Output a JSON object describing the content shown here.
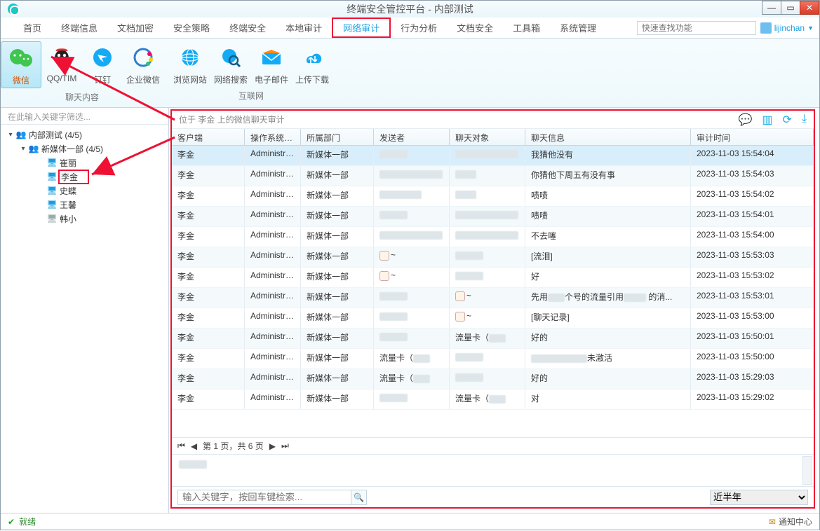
{
  "window": {
    "title": "终端安全管控平台 - 内部测试"
  },
  "menubar": {
    "items": [
      "首页",
      "终端信息",
      "文档加密",
      "安全策略",
      "终端安全",
      "本地审计",
      "网络审计",
      "行为分析",
      "文档安全",
      "工具箱",
      "系统管理"
    ],
    "active_index": 6,
    "search_placeholder": "快速查找功能",
    "user": "lijinchan"
  },
  "ribbon": {
    "group1_caption": "聊天内容",
    "group2_caption": "互联网",
    "buttons": [
      {
        "label": "微信",
        "selected": true
      },
      {
        "label": "QQ/TIM"
      },
      {
        "label": "钉钉"
      },
      {
        "label": "企业微信"
      },
      {
        "label": "浏览网站"
      },
      {
        "label": "网络搜索"
      },
      {
        "label": "电子邮件"
      },
      {
        "label": "上传下载"
      }
    ]
  },
  "sidebar": {
    "filter_placeholder": "在此输入关键字筛选...",
    "tree": {
      "root": {
        "label": "内部测试 (4/5)"
      },
      "child": {
        "label": "新媒体一部 (4/5)"
      },
      "leaves": [
        {
          "label": "崔丽",
          "online": true
        },
        {
          "label": "李金",
          "online": true,
          "selected": true
        },
        {
          "label": "史蝶",
          "online": true
        },
        {
          "label": "王馨",
          "online": true
        },
        {
          "label": "韩小",
          "online": false
        }
      ]
    }
  },
  "content": {
    "path": "位于 李金 上的微信聊天审计",
    "columns": [
      "客户端",
      "操作系统账户",
      "所属部门",
      "发送者",
      "聊天对象",
      "聊天信息",
      "审计时间"
    ],
    "rows": [
      {
        "client": "李金",
        "os": "Administra...",
        "dept": "新媒体一部",
        "sender": "__blur40__",
        "target": "__blur90__",
        "msg": "我猜他没有",
        "time": "2023-11-03 15:54:04",
        "sel": true
      },
      {
        "client": "李金",
        "os": "Administra...",
        "dept": "新媒体一部",
        "sender": "__blur90__",
        "target": "__blur30__",
        "msg": "你猜他下周五有没有事",
        "time": "2023-11-03 15:54:03"
      },
      {
        "client": "李金",
        "os": "Administra...",
        "dept": "新媒体一部",
        "sender": "__blur60__",
        "target": "__blur30__",
        "msg": "啧啧",
        "time": "2023-11-03 15:54:02"
      },
      {
        "client": "李金",
        "os": "Administra...",
        "dept": "新媒体一部",
        "sender": "__blur40__",
        "target": "__blur90__",
        "msg": "啧啧",
        "time": "2023-11-03 15:54:01"
      },
      {
        "client": "李金",
        "os": "Administra...",
        "dept": "新媒体一部",
        "sender": "__blur90__",
        "target": "__blur90__",
        "msg": "不去噻",
        "time": "2023-11-03 15:54:00"
      },
      {
        "client": "李金",
        "os": "Administra...",
        "dept": "新媒体一部",
        "sender": "__emoji__~",
        "target": "__blur40__",
        "msg": "[流泪]",
        "time": "2023-11-03 15:53:03"
      },
      {
        "client": "李金",
        "os": "Administra...",
        "dept": "新媒体一部",
        "sender": "__emoji__~",
        "target": "__blur40__",
        "msg": "好",
        "time": "2023-11-03 15:53:02"
      },
      {
        "client": "李金",
        "os": "Administra...",
        "dept": "新媒体一部",
        "sender": "__blur40__",
        "target": "__emoji__~",
        "msg": "先用███个号的流量引用████ 的消...",
        "time": "2023-11-03 15:53:01"
      },
      {
        "client": "李金",
        "os": "Administra...",
        "dept": "新媒体一部",
        "sender": "__blur40__",
        "target": "__emoji__~",
        "msg": "[聊天记录]",
        "time": "2023-11-03 15:53:00"
      },
      {
        "client": "李金",
        "os": "Administra...",
        "dept": "新媒体一部",
        "sender": "__blur40__",
        "target": "流量卡（███办...",
        "msg": "好的",
        "time": "2023-11-03 15:50:01"
      },
      {
        "client": "李金",
        "os": "Administra...",
        "dept": "新媒体一部",
        "sender": "流量卡（███办...",
        "target": "__blur40__",
        "msg": "██████████未激活",
        "time": "2023-11-03 15:50:00"
      },
      {
        "client": "李金",
        "os": "Administra...",
        "dept": "新媒体一部",
        "sender": "流量卡（███办...",
        "target": "__blur40__",
        "msg": "好的",
        "time": "2023-11-03 15:29:03"
      },
      {
        "client": "李金",
        "os": "Administra...",
        "dept": "新媒体一部",
        "sender": "__blur40__",
        "target": "流量卡（███办...",
        "msg": "对",
        "time": "2023-11-03 15:29:02"
      }
    ],
    "pager": "第 1 页，共 6 页",
    "search_placeholder": "输入关键字，按回车键检索...",
    "range_value": "近半年"
  },
  "statusbar": {
    "text": "就绪",
    "notify": "通知中心"
  }
}
